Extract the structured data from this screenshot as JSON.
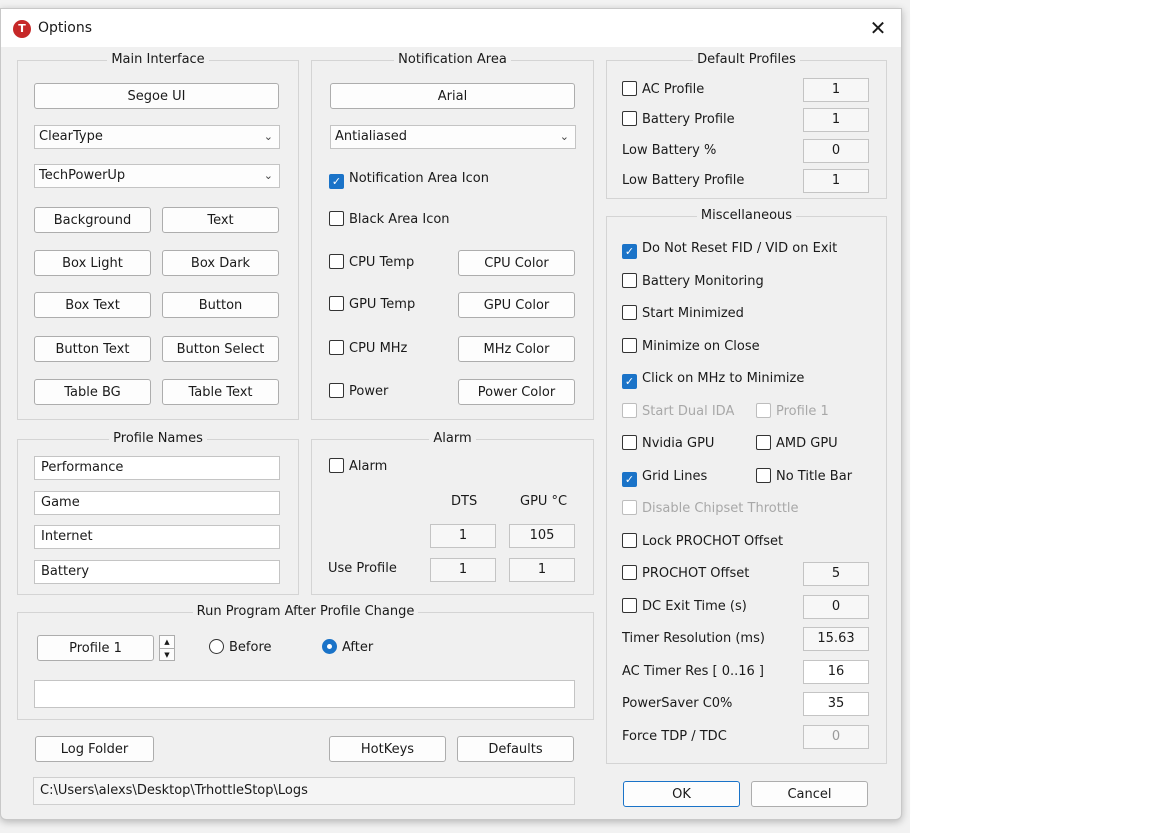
{
  "window": {
    "title": "Options",
    "app_icon": "T",
    "close_label": "✕"
  },
  "main_interface": {
    "title": "Main Interface",
    "font_button": "Segoe UI",
    "rendering": "ClearType",
    "theme": "TechPowerUp",
    "color_buttons": [
      "Background",
      "Text",
      "Box Light",
      "Box Dark",
      "Box Text",
      "Button",
      "Button Text",
      "Button Select",
      "Table BG",
      "Table Text"
    ]
  },
  "notification_area": {
    "title": "Notification Area",
    "font_button": "Arial",
    "rendering": "Antialiased",
    "notification_icon": {
      "label": "Notification Area Icon",
      "checked": true
    },
    "black_icon": {
      "label": "Black Area Icon",
      "checked": false
    },
    "rows": [
      {
        "label": "CPU Temp",
        "checked": false,
        "button": "CPU Color"
      },
      {
        "label": "GPU Temp",
        "checked": false,
        "button": "GPU Color"
      },
      {
        "label": "CPU MHz",
        "checked": false,
        "button": "MHz Color"
      },
      {
        "label": "Power",
        "checked": false,
        "button": "Power Color"
      }
    ]
  },
  "default_profiles": {
    "title": "Default Profiles",
    "ac_profile": {
      "label": "AC Profile",
      "checked": false,
      "value": "1"
    },
    "battery_profile": {
      "label": "Battery Profile",
      "checked": false,
      "value": "1"
    },
    "low_battery_pct": {
      "label": "Low Battery %",
      "value": "0"
    },
    "low_battery_profile": {
      "label": "Low Battery Profile",
      "value": "1"
    }
  },
  "misc": {
    "title": "Miscellaneous",
    "do_not_reset": {
      "label": "Do Not Reset FID / VID on Exit",
      "checked": true
    },
    "battery_monitoring": {
      "label": "Battery Monitoring",
      "checked": false
    },
    "start_minimized": {
      "label": "Start Minimized",
      "checked": false
    },
    "minimize_on_close": {
      "label": "Minimize on Close",
      "checked": false
    },
    "click_mhz": {
      "label": "Click on MHz to Minimize",
      "checked": true
    },
    "start_dual_ida": {
      "label": "Start Dual IDA",
      "checked": false
    },
    "profile_1": {
      "label": "Profile 1",
      "checked": false
    },
    "nvidia_gpu": {
      "label": "Nvidia GPU",
      "checked": false
    },
    "amd_gpu": {
      "label": "AMD GPU",
      "checked": false
    },
    "grid_lines": {
      "label": "Grid Lines",
      "checked": true
    },
    "no_title_bar": {
      "label": "No Title Bar",
      "checked": false
    },
    "disable_chipset": {
      "label": "Disable Chipset Throttle",
      "checked": false
    },
    "lock_prochot": {
      "label": "Lock PROCHOT Offset",
      "checked": false
    },
    "prochot_offset": {
      "label": "PROCHOT Offset",
      "checked": false,
      "value": "5"
    },
    "dc_exit_time": {
      "label": "DC Exit Time (s)",
      "checked": false,
      "value": "0"
    },
    "timer_resolution": {
      "label": "Timer Resolution (ms)",
      "value": "15.63"
    },
    "ac_timer_res": {
      "label": "AC Timer Res [ 0..16 ]",
      "value": "16"
    },
    "powersaver": {
      "label": "PowerSaver C0%",
      "value": "35"
    },
    "force_tdp": {
      "label": "Force TDP / TDC",
      "value": "0"
    }
  },
  "profile_names": {
    "title": "Profile Names",
    "names": [
      "Performance",
      "Game",
      "Internet",
      "Battery"
    ]
  },
  "alarm": {
    "title": "Alarm",
    "alarm_check": {
      "label": "Alarm",
      "checked": false
    },
    "col_dts": "DTS",
    "col_gpu": "GPU °C",
    "dts_value": "1",
    "gpu_value": "105",
    "use_profile_label": "Use Profile",
    "use_profile_dts": "1",
    "use_profile_gpu": "1"
  },
  "run_program": {
    "title": "Run Program After Profile Change",
    "profile_button": "Profile 1",
    "before_label": "Before",
    "after_label": "After",
    "selected": "after",
    "command": ""
  },
  "bottom": {
    "log_folder": "Log Folder",
    "hotkeys": "HotKeys",
    "defaults": "Defaults",
    "log_path": "C:\\Users\\alexs\\Desktop\\TrhottleStop\\Logs",
    "ok": "OK",
    "cancel": "Cancel"
  },
  "colors": {
    "accent": "#1a73c8",
    "app_icon": "#c62828"
  }
}
